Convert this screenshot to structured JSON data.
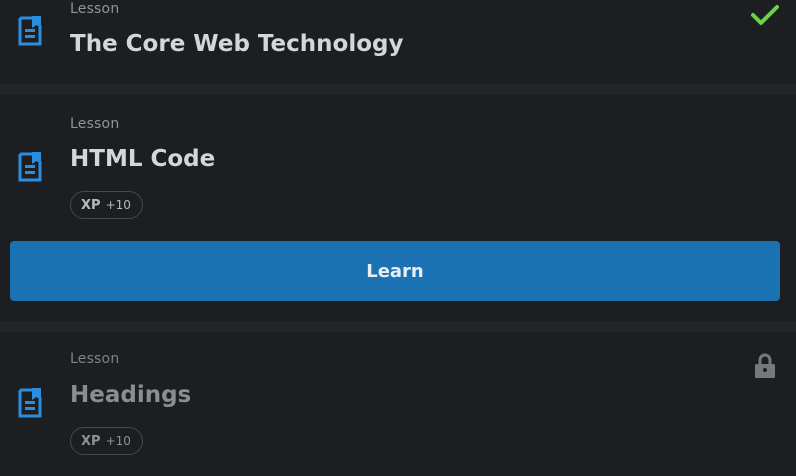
{
  "lessons": [
    {
      "type": "Lesson",
      "title": "The Core Web Technology",
      "status_icon": "check-icon",
      "status_color": "#6dd24a"
    },
    {
      "type": "Lesson",
      "title": "HTML Code",
      "xp_label": "XP",
      "xp_value": "+10",
      "button_label": "Learn"
    },
    {
      "type": "Lesson",
      "title": "Headings",
      "xp_label": "XP",
      "xp_value": "+10",
      "status_icon": "lock-icon"
    }
  ],
  "colors": {
    "accent": "#1b72b3",
    "icon_blue": "#2b8de0",
    "complete": "#6dd24a",
    "background": "#1c1e21"
  }
}
